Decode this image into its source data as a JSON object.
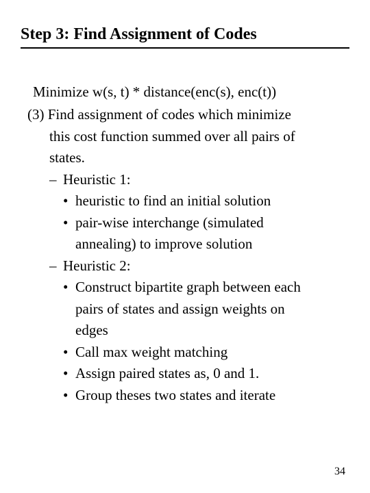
{
  "title": "Step 3: Find Assignment of Codes",
  "objective": "Minimize  w(s, t) * distance(enc(s), enc(t))",
  "point3_lead": "(3) Find assignment of codes which minimize",
  "point3_cont1": "this cost function summed over all pairs of",
  "point3_cont2": "states.",
  "heur1": {
    "label": "Heuristic 1:",
    "b1": "heuristic to find an initial solution",
    "b2_l1": "pair-wise interchange (simulated",
    "b2_l2": "annealing) to improve solution"
  },
  "heur2": {
    "label": "Heuristic 2:",
    "b1_l1": "Construct bipartite graph between each",
    "b1_l2": "pairs of  states  and assign weights on",
    "b1_l3": "edges",
    "b2": "Call max weight matching",
    "b3": "Assign paired states as, 0 and 1.",
    "b4": "Group theses two states and iterate"
  },
  "page_number": "34",
  "marks": {
    "dash": "–",
    "bullet": "•"
  }
}
